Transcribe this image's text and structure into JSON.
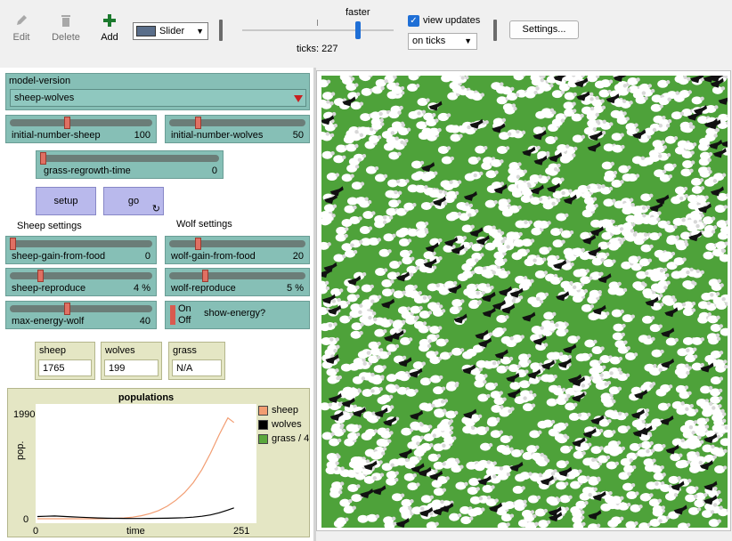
{
  "toolbar": {
    "edit_label": "Edit",
    "delete_label": "Delete",
    "add_label": "Add",
    "widget_type": "Slider",
    "speed_label": "faster",
    "ticks_text": "ticks: 227",
    "view_updates_label": "view updates",
    "update_mode": "on ticks",
    "settings_label": "Settings..."
  },
  "chooser": {
    "name": "model-version",
    "value": "sheep-wolves"
  },
  "sliders": {
    "initial_number_sheep": {
      "name": "initial-number-sheep",
      "value": "100",
      "level": 0.4
    },
    "initial_number_wolves": {
      "name": "initial-number-wolves",
      "value": "50",
      "level": 0.2
    },
    "grass_regrowth_time": {
      "name": "grass-regrowth-time",
      "value": "0",
      "level": 0.0
    },
    "sheep_gain_from_food": {
      "name": "sheep-gain-from-food",
      "value": "0",
      "level": 0.0
    },
    "wolf_gain_from_food": {
      "name": "wolf-gain-from-food",
      "value": "20",
      "level": 0.2
    },
    "sheep_reproduce": {
      "name": "sheep-reproduce",
      "value": "4 %",
      "level": 0.2
    },
    "wolf_reproduce": {
      "name": "wolf-reproduce",
      "value": "5 %",
      "level": 0.25
    },
    "max_energy_wolf": {
      "name": "max-energy-wolf",
      "value": "40",
      "level": 0.4
    }
  },
  "buttons": {
    "setup": "setup",
    "go": "go",
    "go_forever_icon": "↻"
  },
  "notes": {
    "sheep_settings": "Sheep settings",
    "wolf_settings": "Wolf settings"
  },
  "switch": {
    "name": "show-energy?",
    "on_label": "On",
    "off_label": "Off",
    "state": "off"
  },
  "monitors": [
    {
      "name": "sheep",
      "value": "1765"
    },
    {
      "name": "wolves",
      "value": "199"
    },
    {
      "name": "grass",
      "value": "N/A"
    }
  ],
  "plot": {
    "title": "populations",
    "ylabel": "pop.",
    "xlabel": "time",
    "ymax_label": "1990",
    "ymin_label": "0",
    "xmin_label": "0",
    "xmax_label": "251"
  },
  "chart_data": {
    "type": "line",
    "title": "populations",
    "xlabel": "time",
    "ylabel": "pop.",
    "xlim": [
      0,
      251
    ],
    "ylim": [
      0,
      1990
    ],
    "x": [
      0,
      10,
      20,
      30,
      40,
      50,
      60,
      70,
      80,
      90,
      100,
      110,
      120,
      130,
      140,
      150,
      160,
      170,
      180,
      190,
      200,
      210,
      220,
      227
    ],
    "series": [
      {
        "name": "sheep",
        "color": "#f29d72",
        "values": [
          0,
          0,
          0,
          0,
          0,
          0,
          0,
          0,
          2,
          8,
          15,
          30,
          55,
          95,
          150,
          230,
          340,
          480,
          660,
          900,
          1200,
          1540,
          1850,
          1765
        ]
      },
      {
        "name": "wolves",
        "color": "#000000",
        "values": [
          40,
          45,
          50,
          42,
          35,
          28,
          22,
          15,
          10,
          8,
          6,
          5,
          5,
          6,
          8,
          10,
          14,
          20,
          30,
          45,
          70,
          110,
          160,
          199
        ]
      },
      {
        "name": "grass / 4",
        "color": "#5aa83c",
        "values": []
      }
    ],
    "legend": "right"
  },
  "world": {
    "background": "#4ea23a"
  },
  "colors": {
    "slider": "#86bfb6",
    "button": "#b9b9ec",
    "monitor": "#e4e6c4",
    "thumb": "#e07063"
  }
}
